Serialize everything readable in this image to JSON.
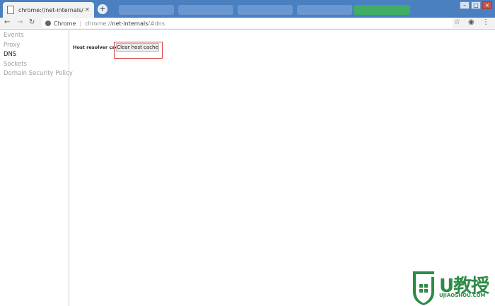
{
  "browser": {
    "active_tab_title": "chrome://net-internals/#dns",
    "tab_close": "×",
    "new_tab": "+",
    "omnibox": {
      "scheme_label": "Chrome",
      "url_scheme": "chrome://",
      "url_host": "net-internals",
      "url_path": "/#dns"
    },
    "window_controls": [
      "–",
      "□",
      "×"
    ]
  },
  "sidebar": {
    "items": [
      {
        "label": "Events",
        "selected": false
      },
      {
        "label": "Proxy",
        "selected": false
      },
      {
        "label": "DNS",
        "selected": true
      },
      {
        "label": "Sockets",
        "selected": false
      },
      {
        "label": "Domain Security Policy",
        "selected": false
      }
    ]
  },
  "main": {
    "host_resolver_label": "Host resolver cache",
    "clear_button_label": "Clear host cache"
  },
  "watermark": {
    "brand": "U教授",
    "domain": "UJIAOSHOU.COM"
  },
  "colors": {
    "titlebar": "#4a7fc0",
    "highlight_border": "#d23b3b",
    "watermark_green": "#2e8a47"
  }
}
